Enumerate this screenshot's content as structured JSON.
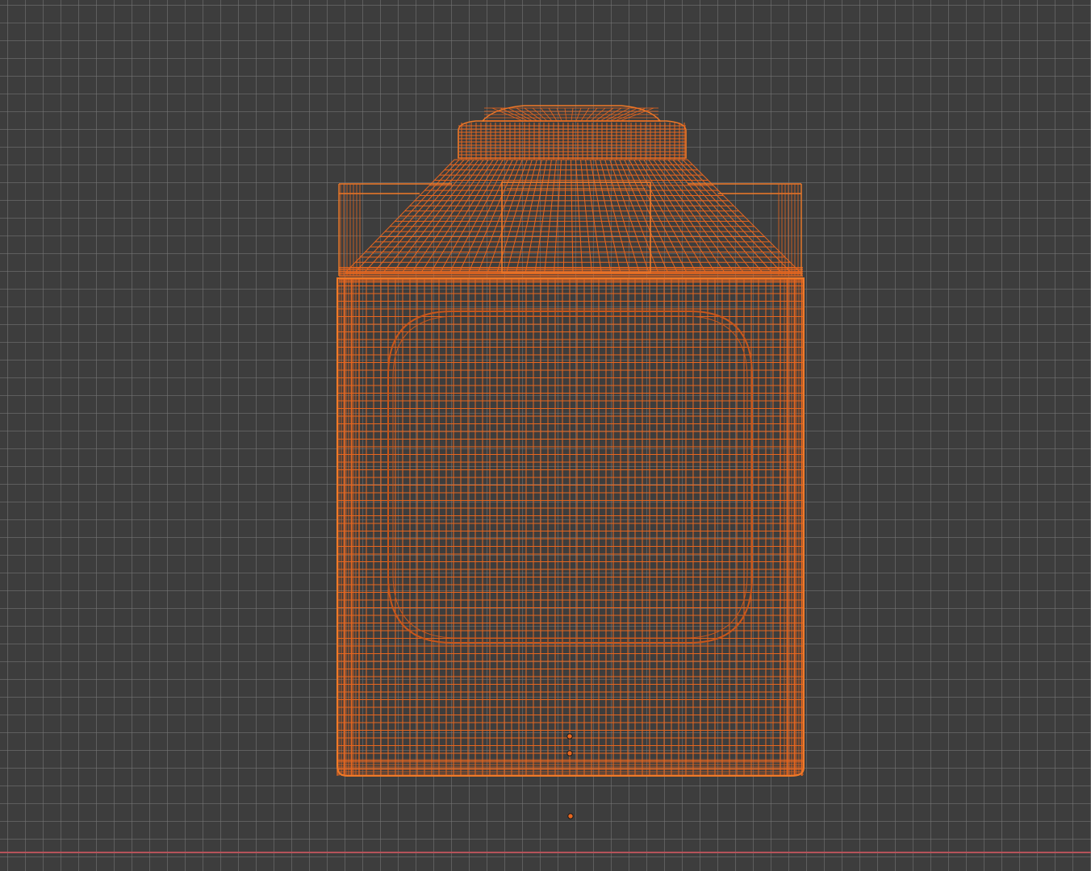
{
  "viewport": {
    "background_color": "#3d3d3d",
    "grid_color": "#787878",
    "x_axis_color": "#b5535a",
    "grid": true
  },
  "object": {
    "display_mode": "wireframe",
    "selected": true,
    "wire_color": "#e8661e",
    "outline_color": "#f07a28",
    "point_color": "#e8661e"
  }
}
